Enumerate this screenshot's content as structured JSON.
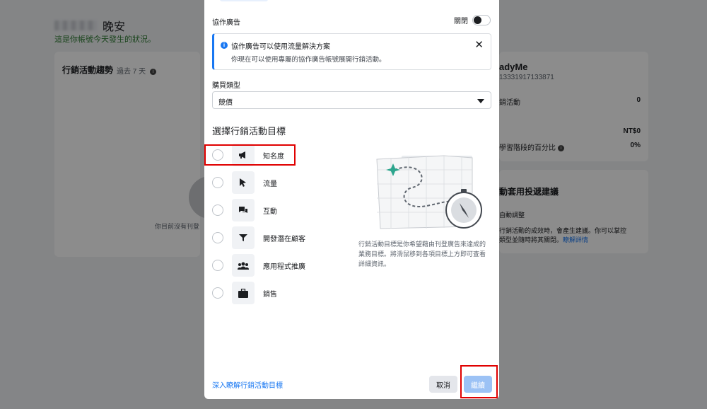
{
  "background": {
    "greeting": "晚安",
    "greeting_sub": "這是你帳號今天發生的狀況。",
    "trend_card": {
      "title": "行銷活動趨勢",
      "range": "過去 7 天",
      "empty_text": "你目前沒有刊登"
    },
    "account_card": {
      "name": "adyMe",
      "id": "13331917133871",
      "rows": [
        {
          "label": "銷活動",
          "value": "0"
        },
        {
          "label": "",
          "value": "NT$0"
        },
        {
          "label": "學習階段的百分比",
          "value": "0%"
        }
      ]
    },
    "suggest_card": {
      "title": "動套用投遞建議",
      "sub": "自動調整",
      "desc": "行銷活動的成效時，會產生建議。你可以掌控",
      "desc2": "類型並隨時將其關閉。",
      "link": "瞭解詳情"
    }
  },
  "modal": {
    "collab": {
      "label": "協作廣告",
      "toggle_label": "關閉",
      "toggle_on": false
    },
    "notice": {
      "title": "協作廣告可以使用流量解決方案",
      "body": "你現在可以使用專屬的協作廣告帳號展開行銷活動。"
    },
    "buying_type": {
      "label": "購買類型",
      "value": "競價"
    },
    "objective_heading": "選擇行銷活動目標",
    "objectives": [
      {
        "label": "知名度",
        "icon": "megaphone-icon"
      },
      {
        "label": "流量",
        "icon": "cursor-icon"
      },
      {
        "label": "互動",
        "icon": "chat-icon"
      },
      {
        "label": "開發潛在顧客",
        "icon": "funnel-icon"
      },
      {
        "label": "應用程式推廣",
        "icon": "people-icon"
      },
      {
        "label": "銷售",
        "icon": "briefcase-icon"
      }
    ],
    "illustration_text": "行銷活動目標是你希望藉由刊登廣告來達成的業務目標。將滑鼠移到各項目標上方即可查看詳細資訊。",
    "learn_link": "深入瞭解行銷活動目標",
    "cancel_label": "取消",
    "continue_label": "繼續"
  },
  "colors": {
    "accent": "#1877f2",
    "highlight": "#e00000",
    "continue_disabled": "#9cc2f5"
  }
}
